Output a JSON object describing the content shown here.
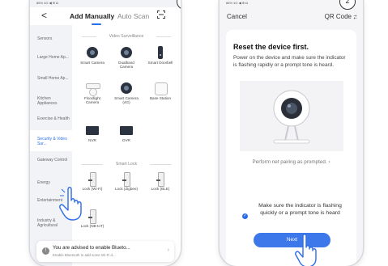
{
  "step1": {
    "badge": "1",
    "status_left": "86% 4G ◀ ⊕ ◘",
    "header": {
      "back": "<",
      "tab_active": "Add Manually",
      "tab_other": "Auto Scan"
    },
    "sidebar": [
      "Sensors",
      "Large Home Ap...",
      "Small Home Ap...",
      "Kitchen Appliances",
      "Exercise & Health",
      "Security & Video Sur...",
      "Gateway Control",
      "Energy",
      "Entertainment",
      "Industry & Agricultural"
    ],
    "active_index": 5,
    "sections": [
      {
        "title": "Video Surveillance",
        "devices": [
          {
            "label": "Smart Camera",
            "icon": "camera-icon"
          },
          {
            "label": "Dualband Camera",
            "icon": "camera-icon"
          },
          {
            "label": "Smart Doorbell",
            "icon": "doorbell-icon"
          },
          {
            "label": "Floodlight Camera",
            "icon": "floodlight-icon"
          },
          {
            "label": "Smart Camera (4G)",
            "icon": "camera-icon"
          },
          {
            "label": "Base Station",
            "icon": "base-station-icon"
          },
          {
            "label": "NVR",
            "icon": "nvr-icon"
          },
          {
            "label": "DVR",
            "icon": "dvr-icon"
          }
        ]
      },
      {
        "title": "Smart Lock",
        "devices": [
          {
            "label": "Lock (Wi-Fi)",
            "icon": "lock-icon"
          },
          {
            "label": "Lock (Zigbee)",
            "icon": "lock-icon"
          },
          {
            "label": "Lock (BLE)",
            "icon": "lock-icon"
          },
          {
            "label": "Lock (NB-IoT)",
            "icon": "lock-icon"
          }
        ]
      }
    ],
    "banner": {
      "title": "You are advised to enable Blueto...",
      "subtitle": "Enable Bluetooth to add some Wi-Fi d...",
      "chevron": "›",
      "icon_text": "!"
    }
  },
  "step2": {
    "badge": "2",
    "status_left": "86% 4G ◀ ⊕ ◘",
    "header": {
      "cancel": "Cancel",
      "qr": "QR Code"
    },
    "title": "Reset the device first.",
    "description": "Power on the device and make sure the indicator is flashing rapidly or a prompt tone is heard.",
    "link": "Perform net pairing as prompted. ›",
    "confirm": "Make sure the indicator is flashing quickly or a prompt tone is heard",
    "check_icon": "✓",
    "next": "Next"
  },
  "colors": {
    "accent": "#2b6de8",
    "button": "#3d78ea"
  }
}
